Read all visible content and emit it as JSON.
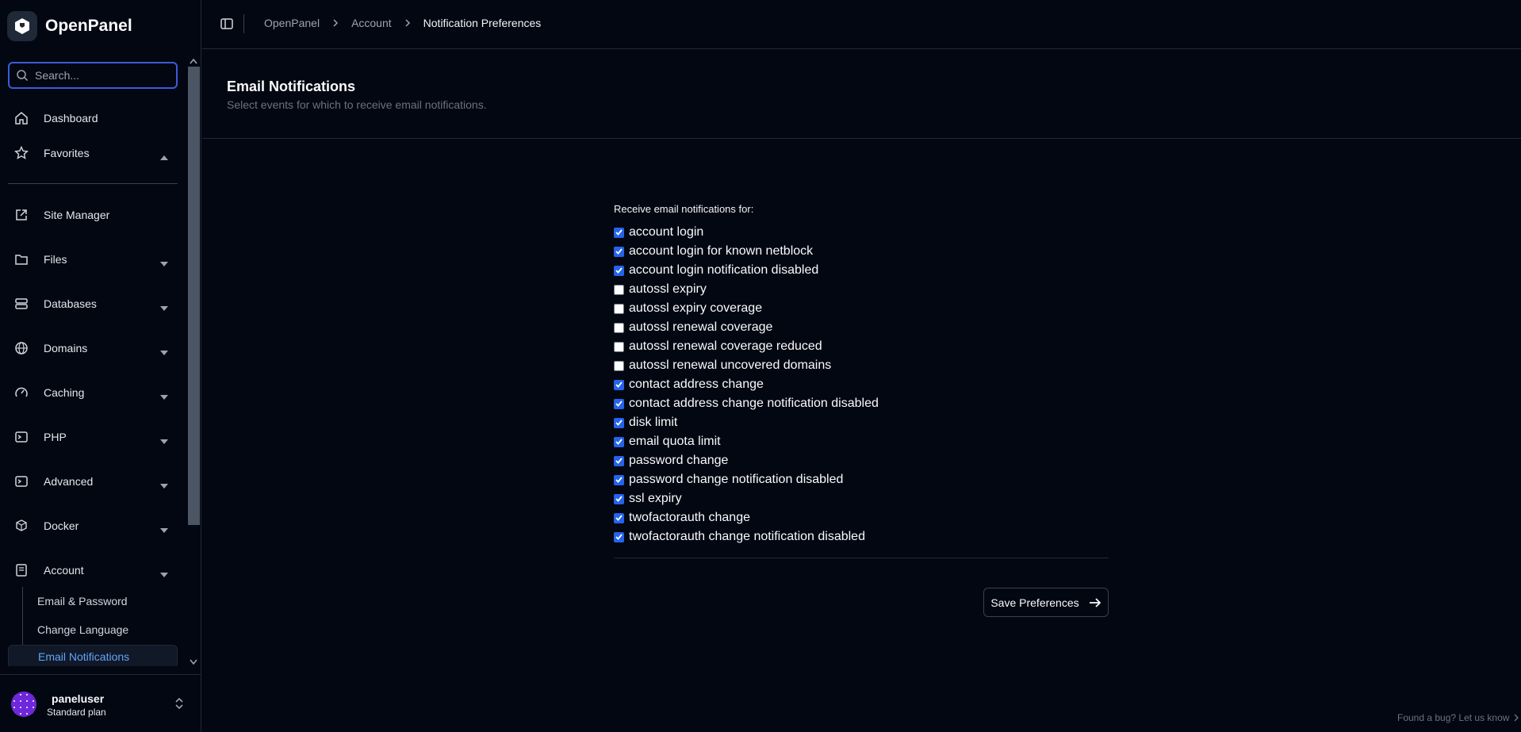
{
  "app": {
    "name": "OpenPanel"
  },
  "search": {
    "placeholder": "Search..."
  },
  "nav": {
    "dashboard": "Dashboard",
    "favorites": "Favorites",
    "site_manager": "Site Manager",
    "files": "Files",
    "databases": "Databases",
    "domains": "Domains",
    "caching": "Caching",
    "php": "PHP",
    "advanced": "Advanced",
    "docker": "Docker",
    "account": "Account",
    "account_sub": [
      "Email & Password",
      "Change Language",
      "Email Notifications"
    ],
    "active_sub": "Email Notifications"
  },
  "user": {
    "name": "paneluser",
    "plan": "Standard plan"
  },
  "breadcrumb": [
    "OpenPanel",
    "Account",
    "Notification Preferences"
  ],
  "page": {
    "title": "Email Notifications",
    "description": "Select events for which to receive email notifications."
  },
  "form": {
    "legend": "Receive email notifications for:",
    "options": [
      {
        "label": "account login",
        "checked": true
      },
      {
        "label": "account login for known netblock",
        "checked": true
      },
      {
        "label": "account login notification disabled",
        "checked": true
      },
      {
        "label": "autossl expiry",
        "checked": false
      },
      {
        "label": "autossl expiry coverage",
        "checked": false
      },
      {
        "label": "autossl renewal coverage",
        "checked": false
      },
      {
        "label": "autossl renewal coverage reduced",
        "checked": false
      },
      {
        "label": "autossl renewal uncovered domains",
        "checked": false
      },
      {
        "label": "contact address change",
        "checked": true
      },
      {
        "label": "contact address change notification disabled",
        "checked": true
      },
      {
        "label": "disk limit",
        "checked": true
      },
      {
        "label": "email quota limit",
        "checked": true
      },
      {
        "label": "password change",
        "checked": true
      },
      {
        "label": "password change notification disabled",
        "checked": true
      },
      {
        "label": "ssl expiry",
        "checked": true
      },
      {
        "label": "twofactorauth change",
        "checked": true
      },
      {
        "label": "twofactorauth change notification disabled",
        "checked": true
      }
    ],
    "save_label": "Save Preferences"
  },
  "footer": {
    "bug_link": "Found a bug? Let us know"
  },
  "colors": {
    "accent": "#2563eb",
    "active_link": "#60a5fa",
    "background": "#030712"
  }
}
